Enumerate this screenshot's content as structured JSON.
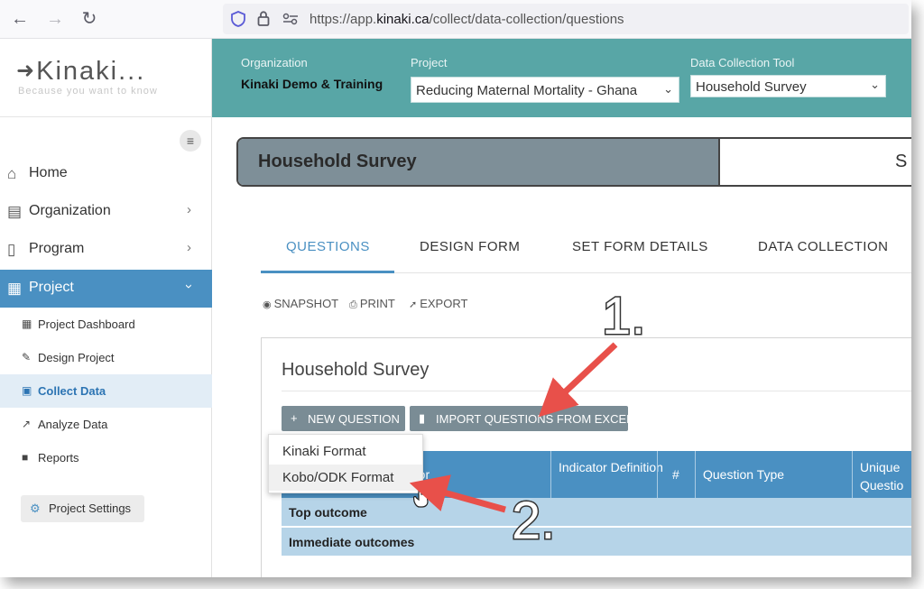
{
  "browser": {
    "url_prefix": "https://app.",
    "url_domain": "kinaki.ca",
    "url_path": "/collect/data-collection/questions"
  },
  "sidebar": {
    "logo": "Kinaki...",
    "tagline": "Because you want to know",
    "nav": [
      {
        "label": "Home"
      },
      {
        "label": "Organization"
      },
      {
        "label": "Program"
      },
      {
        "label": "Project"
      }
    ],
    "subnav": [
      {
        "label": "Project Dashboard"
      },
      {
        "label": "Design Project"
      },
      {
        "label": "Collect Data"
      },
      {
        "label": "Analyze Data"
      },
      {
        "label": "Reports"
      }
    ],
    "settings_label": "Project Settings"
  },
  "header": {
    "org_label": "Organization",
    "org_name": "Kinaki Demo & Training",
    "project_label": "Project",
    "project_value": "Reducing Maternal Mortality - Ghana",
    "tool_label": "Data Collection Tool",
    "tool_value": "Household Survey"
  },
  "survey_bar": {
    "title": "Household Survey",
    "right_text": "S"
  },
  "tabs": [
    {
      "label": "QUESTIONS"
    },
    {
      "label": "DESIGN FORM"
    },
    {
      "label": "SET FORM DETAILS"
    },
    {
      "label": "DATA COLLECTION"
    }
  ],
  "actions": {
    "snapshot": "SNAPSHOT",
    "print": "PRINT",
    "export": "EXPORT"
  },
  "panel": {
    "title": "Household Survey",
    "new_question": "NEW QUESTION",
    "import_questions": "IMPORT QUESTIONS FROM EXCEL",
    "menu": [
      "Kinaki Format",
      "Kobo/ODK Format"
    ],
    "columns": [
      "ator",
      "Indicator Definition",
      "#",
      "Question Type",
      "Unique Questio"
    ],
    "groups": [
      "Top outcome",
      "Immediate outcomes"
    ]
  },
  "annotations": {
    "step1": "1.",
    "step2": "2.",
    "arrow_color": "#e8504a"
  },
  "colors": {
    "accent": "#4a90c2",
    "header_teal": "#58a6a6",
    "button_gray": "#7a8c95"
  }
}
